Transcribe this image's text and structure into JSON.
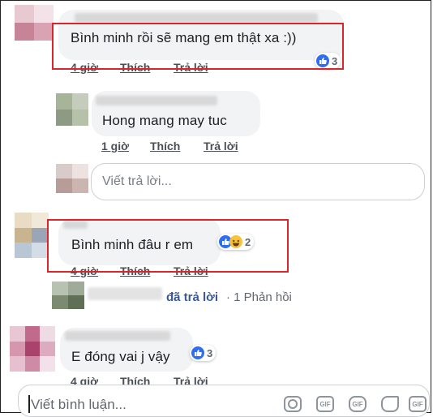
{
  "comments": [
    {
      "text": "Bình minh rồi sẽ mang em thật xa :))",
      "actions": [
        "4 giờ",
        "Thích",
        "Trả lời"
      ],
      "reactions": {
        "count": "3",
        "icons": [
          "like-icon"
        ]
      }
    },
    {
      "text": "Hong mang may tuc",
      "actions": [
        "1 giờ",
        "Thích",
        "Trả lời"
      ]
    },
    {
      "text": "Bình minh đâu r em",
      "actions": [
        "4 giờ",
        "Thích",
        "Trả lời"
      ],
      "reactions": {
        "count": "2",
        "icons": [
          "like-icon",
          "haha-icon"
        ]
      },
      "replies_summary": {
        "label": "đã trả lời",
        "count_text": "· 1 Phản hồi"
      }
    },
    {
      "text": "E đóng vai j vậy",
      "actions": [
        "4 giờ",
        "Thích",
        "Trả lời"
      ],
      "reactions": {
        "count": "3",
        "icons": [
          "like-icon"
        ]
      }
    }
  ],
  "reply_input": {
    "placeholder": "Viết trả lời..."
  },
  "comment_input": {
    "placeholder": "Viết bình luận...",
    "tools": [
      {
        "name": "camera-icon",
        "label": ""
      },
      {
        "name": "gif-icon",
        "label": "GIF"
      },
      {
        "name": "gif-alt-icon",
        "label": "GIF"
      },
      {
        "name": "sticker-icon",
        "label": ""
      },
      {
        "name": "gif-icon-2",
        "label": "GIF"
      }
    ]
  },
  "colors": {
    "highlight": "#d9262a",
    "like": "#2d6ff0",
    "bubble": "#f2f3f5"
  }
}
